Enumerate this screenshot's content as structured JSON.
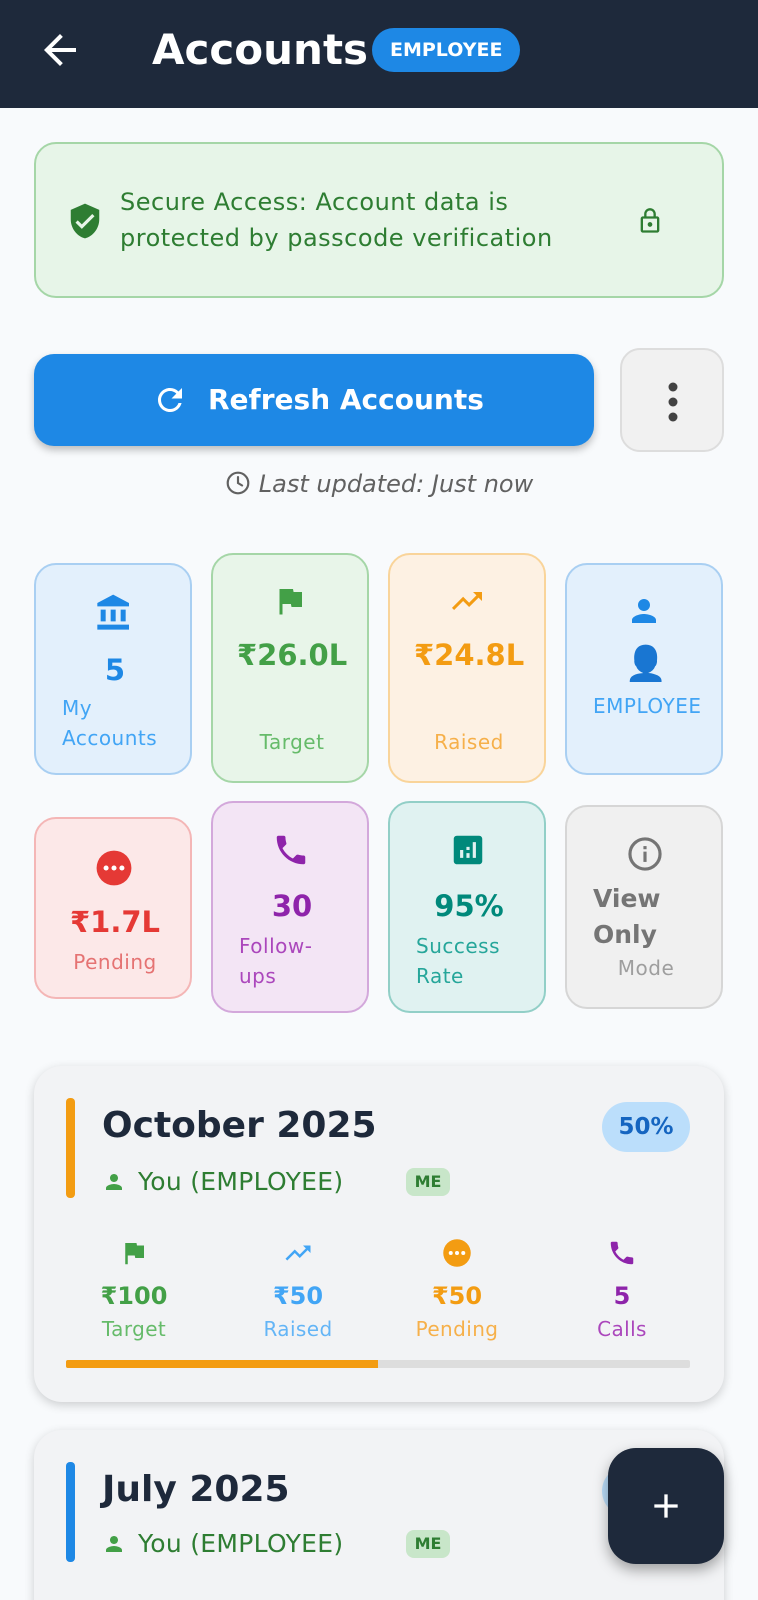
{
  "header": {
    "title": "Accounts",
    "role_badge": "EMPLOYEE",
    "back_icon": "arrow-back-icon"
  },
  "security_banner": {
    "text": "Secure Access: Account data is protected by passcode verification",
    "icons": [
      "shield-check-icon",
      "lock-icon"
    ],
    "color": "#2e7d32"
  },
  "actions": {
    "refresh_label": "Refresh Accounts",
    "more_icon": "more-vertical-icon",
    "primary_color": "#1e88e5"
  },
  "last_updated": "Last updated: Just now",
  "stats": [
    {
      "icon": "bank-icon",
      "value": "5",
      "label": "My Accounts",
      "color": "#1e88e5"
    },
    {
      "icon": "flag-icon",
      "value": "₹26.0L",
      "label": "Target",
      "color": "#43a047"
    },
    {
      "icon": "trending-up-icon",
      "value": "₹24.8L",
      "label": "Raised",
      "color": "#f39c12"
    },
    {
      "icon": "person-icon",
      "value": "👤",
      "label": "EMPLOYEE",
      "color": "#1e88e5"
    },
    {
      "icon": "pending-icon",
      "value": "₹1.7L",
      "label": "Pending",
      "color": "#e53935"
    },
    {
      "icon": "phone-icon",
      "value": "30",
      "label": "Follow-ups",
      "color": "#8e24aa"
    },
    {
      "icon": "analytics-icon",
      "value": "95%",
      "label": "Success Rate",
      "color": "#00897b"
    },
    {
      "icon": "info-icon",
      "value": "View Only",
      "label": "Mode",
      "color": "#757575"
    }
  ],
  "months": [
    {
      "title": "October 2025",
      "percent_label": "50%",
      "progress": 0.5,
      "accent": "#f39c12",
      "owner": "You (EMPLOYEE)",
      "me_badge": "ME",
      "metrics": [
        {
          "icon": "flag-icon",
          "value": "₹100",
          "label": "Target",
          "color": "#43a047"
        },
        {
          "icon": "trending-up-icon",
          "value": "₹50",
          "label": "Raised",
          "color": "#42a5f5"
        },
        {
          "icon": "pending-icon",
          "value": "₹50",
          "label": "Pending",
          "color": "#f39c12"
        },
        {
          "icon": "phone-icon",
          "value": "5",
          "label": "Calls",
          "color": "#8e24aa"
        }
      ]
    },
    {
      "title": "July 2025",
      "accent": "#1e88e5",
      "owner": "You (EMPLOYEE)",
      "me_badge": "ME"
    }
  ],
  "fab": {
    "icon": "plus-icon"
  }
}
